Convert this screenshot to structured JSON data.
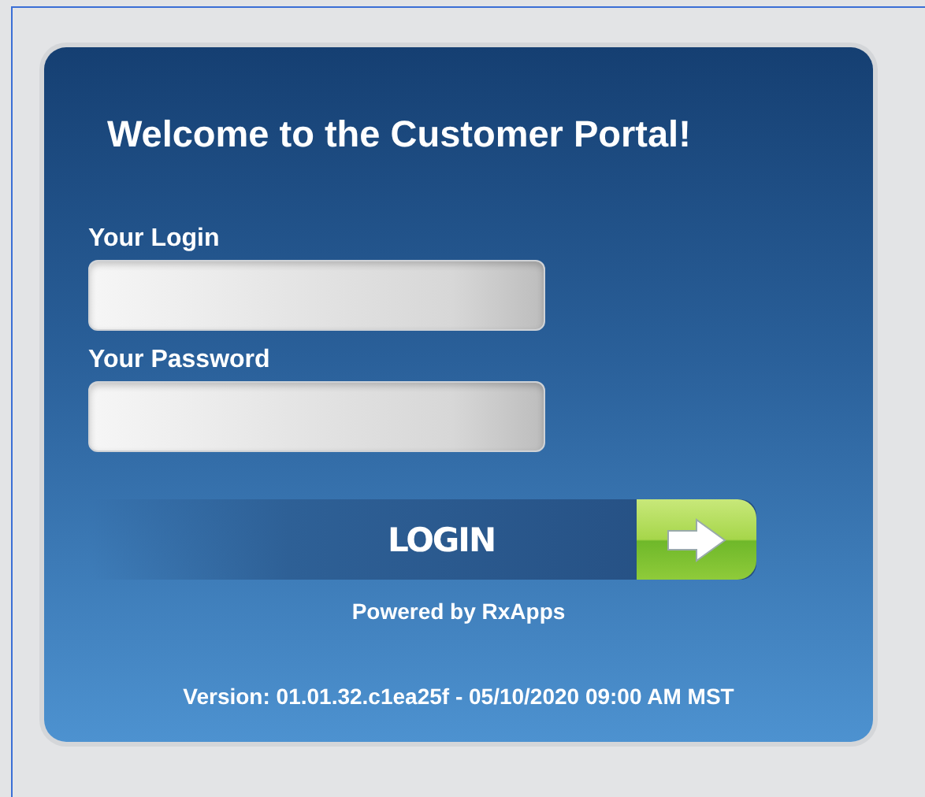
{
  "title": "Welcome to the Customer Portal!",
  "fields": [
    {
      "label": "Your Login"
    },
    {
      "label": "Your Password"
    }
  ],
  "login_button": "LOGIN",
  "powered_by": "Powered by RxApps",
  "version": "Version: 01.01.32.c1ea25f - 05/10/2020 09:00 AM MST"
}
